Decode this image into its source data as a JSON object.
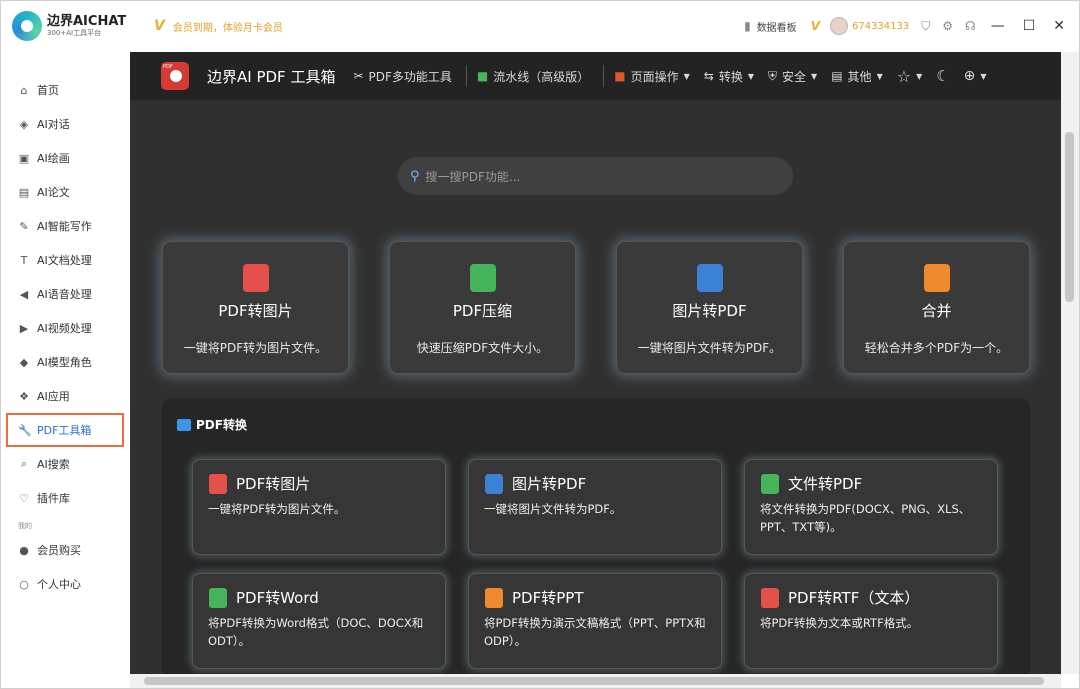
{
  "titlebar": {
    "logo_title": "边界AICHAT",
    "logo_subtitle": "300+AI工具平台",
    "vip_promo": "会员到期，体验月卡会员",
    "dashboard": "数据看板",
    "user_id": "674334133"
  },
  "sidebar": {
    "items": [
      {
        "label": "首页",
        "icon": "home-icon"
      },
      {
        "label": "AI对话",
        "icon": "cube-icon"
      },
      {
        "label": "AI绘画",
        "icon": "image-icon"
      },
      {
        "label": "AI论文",
        "icon": "document-icon"
      },
      {
        "label": "AI智能写作",
        "icon": "pen-icon"
      },
      {
        "label": "AI文档处理",
        "icon": "text-icon"
      },
      {
        "label": "AI语音处理",
        "icon": "speaker-icon"
      },
      {
        "label": "AI视频处理",
        "icon": "video-icon"
      },
      {
        "label": "AI模型角色",
        "icon": "cube-icon"
      },
      {
        "label": "AI应用",
        "icon": "grid-icon"
      },
      {
        "label": "PDF工具箱",
        "icon": "wrench-icon"
      },
      {
        "label": "AI搜索",
        "icon": "search-icon"
      },
      {
        "label": "插件库",
        "icon": "plugin-icon"
      }
    ],
    "group_label": "我的",
    "bottom_items": [
      {
        "label": "会员购买",
        "icon": "user-icon"
      },
      {
        "label": "个人中心",
        "icon": "user-outline-icon"
      }
    ]
  },
  "topnav": {
    "app_title": "边界AI PDF 工具箱",
    "items": [
      {
        "label": "PDF多功能工具",
        "icon": "tools-icon",
        "caret": false
      },
      {
        "label": "流水线（高级版）",
        "icon": "pipeline-icon",
        "caret": false
      },
      {
        "label": "页面操作",
        "icon": "page-icon",
        "caret": true
      },
      {
        "label": "转换",
        "icon": "convert-icon",
        "caret": true
      },
      {
        "label": "安全",
        "icon": "shield-icon",
        "caret": true
      },
      {
        "label": "其他",
        "icon": "menu-icon",
        "caret": true
      }
    ]
  },
  "search": {
    "placeholder": "搜一搜PDF功能..."
  },
  "featured": [
    {
      "title": "PDF转图片",
      "desc": "一键将PDF转为图片文件。",
      "color": "#e5504a"
    },
    {
      "title": "PDF压缩",
      "desc": "快速压缩PDF文件大小。",
      "color": "#46b45b"
    },
    {
      "title": "图片转PDF",
      "desc": "一键将图片文件转为PDF。",
      "color": "#3b82d6"
    },
    {
      "title": "合并",
      "desc": "轻松合并多个PDF为一个。",
      "color": "#ef8a2e"
    }
  ],
  "section": {
    "title": "PDF转换",
    "tools": [
      {
        "title": "PDF转图片",
        "desc": "一键将PDF转为图片文件。"
      },
      {
        "title": "图片转PDF",
        "desc": "一键将图片文件转为PDF。"
      },
      {
        "title": "文件转PDF",
        "desc": "将文件转换为PDF(DOCX、PNG、XLS、PPT、TXT等)。"
      },
      {
        "title": "PDF转Word",
        "desc": "将PDF转换为Word格式（DOC、DOCX和ODT）。"
      },
      {
        "title": "PDF转PPT",
        "desc": "将PDF转换为演示文稿格式（PPT、PPTX和ODP）。"
      },
      {
        "title": "PDF转RTF（文本）",
        "desc": "将PDF转换为文本或RTF格式。"
      }
    ]
  }
}
